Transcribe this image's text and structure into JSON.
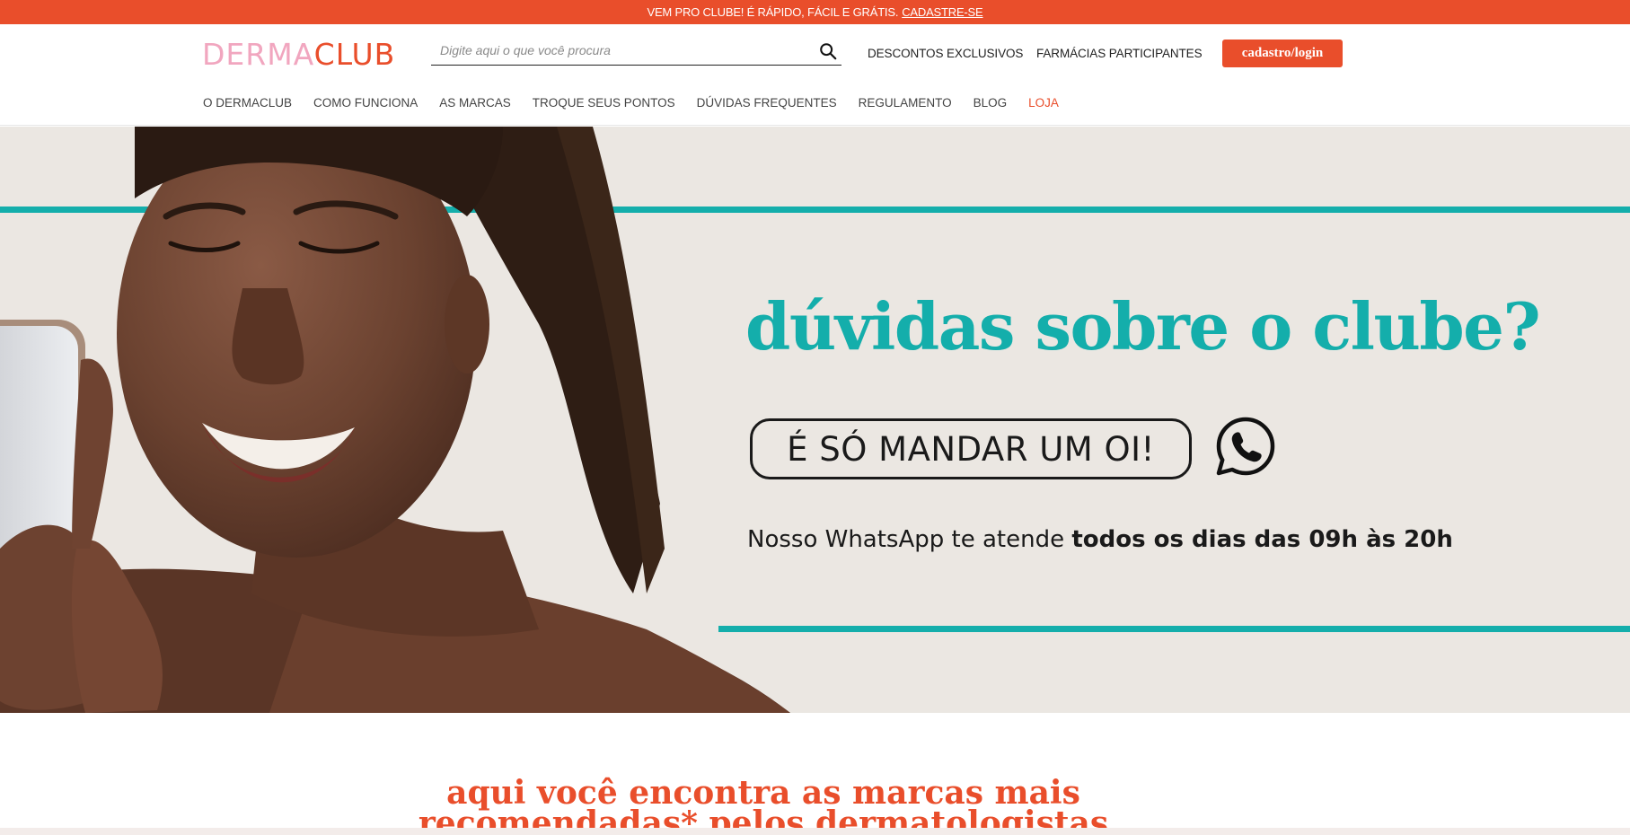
{
  "promo": {
    "text": "VEM PRO CLUBE! É RÁPIDO, FÁCIL E GRÁTIS.",
    "link": "CADASTRE-SE"
  },
  "header": {
    "logo": {
      "part1": "DERMA",
      "part2": "CLUB"
    },
    "search": {
      "placeholder": "Digite aqui o que você procura",
      "value": "",
      "icon": "search-icon"
    },
    "links": {
      "descontos": "DESCONTOS EXCLUSIVOS",
      "farmacias": "FARMÁCIAS PARTICIPANTES"
    },
    "login_label": "cadastro/login"
  },
  "nav": {
    "items": [
      {
        "label": "O DERMACLUB"
      },
      {
        "label": "COMO FUNCIONA"
      },
      {
        "label": "AS MARCAS"
      },
      {
        "label": "TROQUE SEUS PONTOS"
      },
      {
        "label": "DÚVIDAS FREQUENTES"
      },
      {
        "label": "REGULAMENTO"
      },
      {
        "label": "BLOG"
      },
      {
        "label": "LOJA"
      }
    ]
  },
  "hero": {
    "title": "dúvidas sobre o clube?",
    "pill": "É SÓ MANDAR UM OI!",
    "whatsapp_icon": "whatsapp-icon",
    "sub_regular": "Nosso WhatsApp te atende ",
    "sub_bold": "todos os dias das 09h às 20h",
    "colors": {
      "teal": "#14aeab",
      "accent": "#e94e2b",
      "background": "#ebe7e2"
    }
  },
  "brands": {
    "line1": "aqui você encontra as marcas mais",
    "line2": "recomendadas* pelos dermatologistas"
  }
}
